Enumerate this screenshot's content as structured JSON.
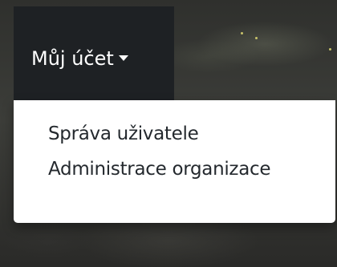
{
  "account_menu": {
    "toggle_label": "Můj účet",
    "items": [
      {
        "label": "Správa uživatele"
      },
      {
        "label": "Administrace organizace"
      }
    ]
  },
  "icons": {
    "caret": "chevron-down-icon"
  }
}
